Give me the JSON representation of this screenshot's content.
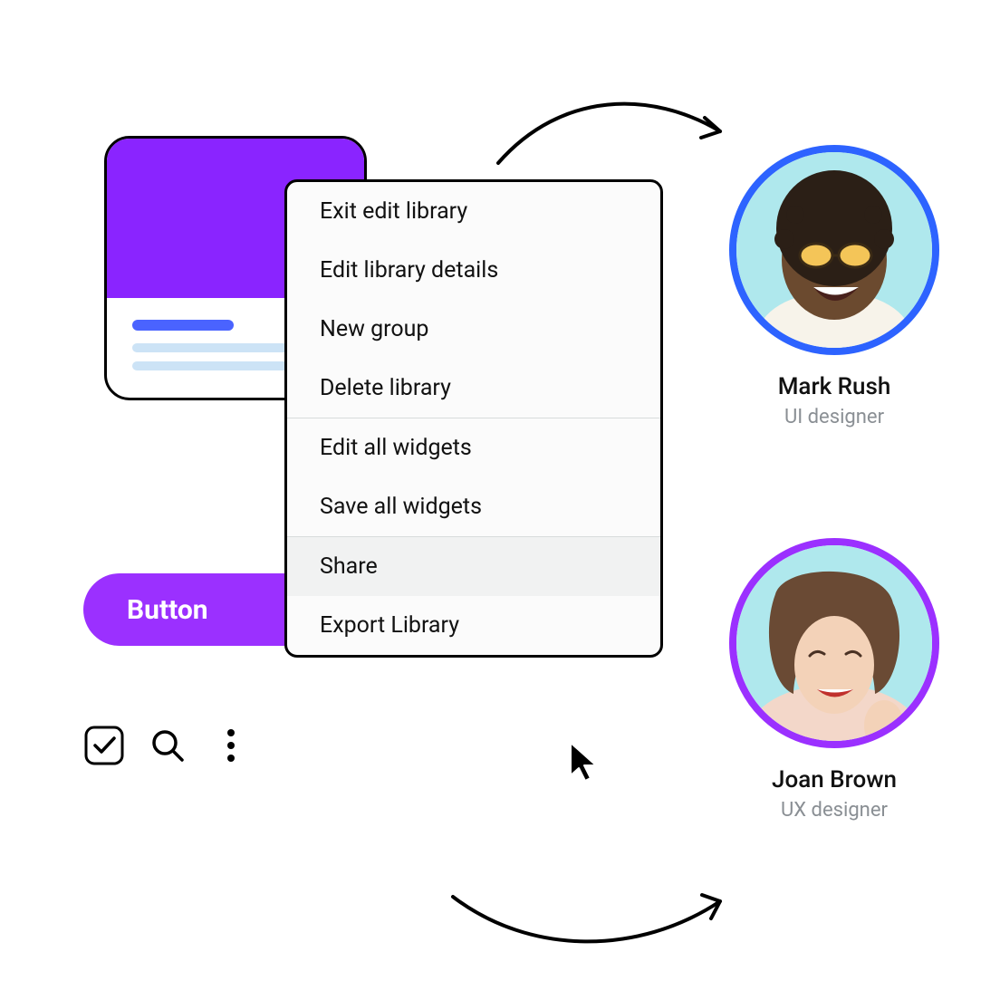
{
  "card": {
    "accent_color": "#8a24ff"
  },
  "button": {
    "label": "Button",
    "color": "#9b30ff"
  },
  "menu": {
    "sections": [
      {
        "items": [
          "Exit edit library",
          "Edit library details",
          "New group",
          "Delete library"
        ]
      },
      {
        "items": [
          "Edit all widgets",
          "Save all widgets"
        ]
      },
      {
        "items": [
          "Share",
          "Export Library"
        ],
        "highlighted": "Share"
      }
    ]
  },
  "people": [
    {
      "name": "Mark Rush",
      "role": "UI designer",
      "ring_color": "#2d63ff"
    },
    {
      "name": "Joan Brown",
      "role": "UX designer",
      "ring_color": "#9b30ff"
    }
  ],
  "toolbar": {
    "items": [
      "checkbox",
      "search",
      "more"
    ]
  }
}
